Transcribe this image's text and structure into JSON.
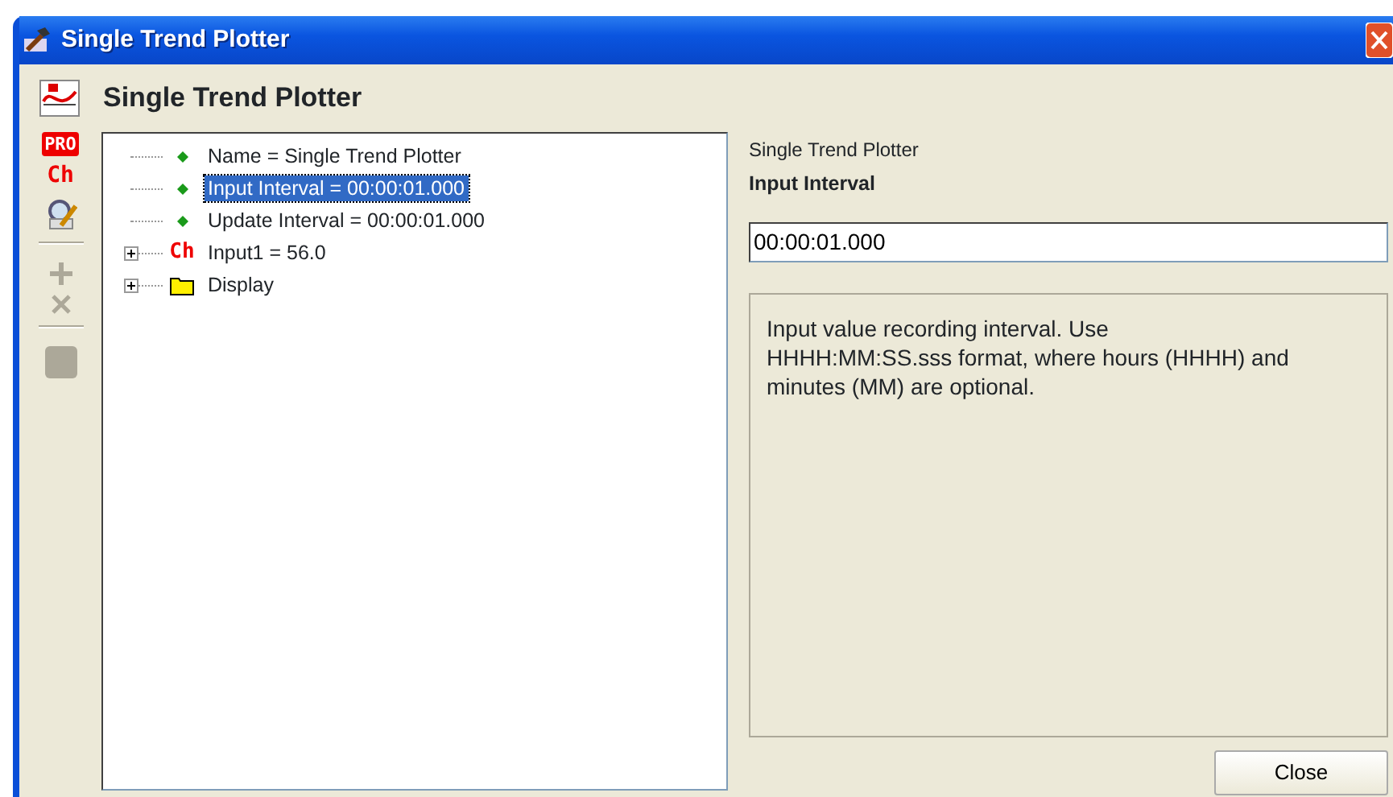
{
  "window": {
    "title": "Single Trend Plotter"
  },
  "header": {
    "title": "Single Trend Plotter"
  },
  "toolbar": [
    {
      "kind": "pro",
      "label": "PRO",
      "disabled": false
    },
    {
      "kind": "channel",
      "label": "Ch",
      "disabled": false
    },
    {
      "kind": "edit",
      "disabled": false
    },
    {
      "kind": "separator"
    },
    {
      "kind": "add",
      "disabled": true
    },
    {
      "kind": "delete",
      "disabled": true
    },
    {
      "kind": "separator"
    },
    {
      "kind": "stop",
      "disabled": true
    }
  ],
  "tree": [
    {
      "kind": "leaf",
      "label": "Name = Single Trend Plotter",
      "selected": false
    },
    {
      "kind": "leaf",
      "label": "Input Interval = 00:00:01.000",
      "selected": true
    },
    {
      "kind": "leaf",
      "label": "Update Interval = 00:00:01.000",
      "selected": false
    },
    {
      "kind": "channel",
      "icon_text": "Ch",
      "label": "Input1 = 56.0",
      "selected": false,
      "expanded": false
    },
    {
      "kind": "folder",
      "label": "Display",
      "selected": false,
      "expanded": false
    }
  ],
  "details": {
    "context": "Single Trend Plotter",
    "property": "Input Interval",
    "value": "00:00:01.000",
    "description": "Input value recording interval. Use HHHH:MM:SS.sss format, where hours (HHHH) and minutes (MM) are optional."
  },
  "buttons": [
    {
      "label": "Close"
    }
  ]
}
